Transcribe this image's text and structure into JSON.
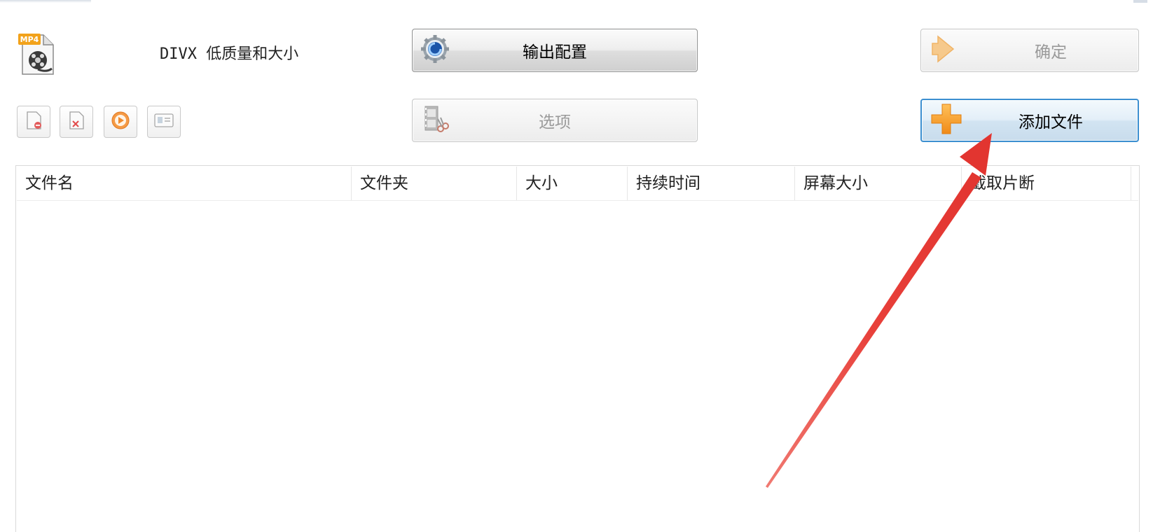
{
  "profile": {
    "label": "DIVX 低质量和大小",
    "icon": "mp4-file-icon",
    "icon_badge": "MP4"
  },
  "buttons": {
    "output_config": {
      "label": "输出配置",
      "icon": "gear-icon"
    },
    "options": {
      "label": "选项",
      "icon": "film-scissors-icon",
      "disabled": true
    },
    "ok": {
      "label": "确定",
      "icon": "arrow-right-icon",
      "disabled": true
    },
    "add_file": {
      "label": "添加文件",
      "icon": "plus-icon",
      "focused": true
    }
  },
  "toolbar": [
    {
      "icon": "remove-file-icon"
    },
    {
      "icon": "clear-list-icon"
    },
    {
      "icon": "play-icon"
    },
    {
      "icon": "media-info-icon"
    }
  ],
  "list": {
    "columns": [
      "文件名",
      "文件夹",
      "大小",
      "持续时间",
      "屏幕大小",
      "截取片断"
    ],
    "rows": []
  },
  "colors": {
    "annotation_arrow": "#e8403a",
    "focus_border": "#3c8fd0",
    "accent_orange": "#f5a623"
  }
}
